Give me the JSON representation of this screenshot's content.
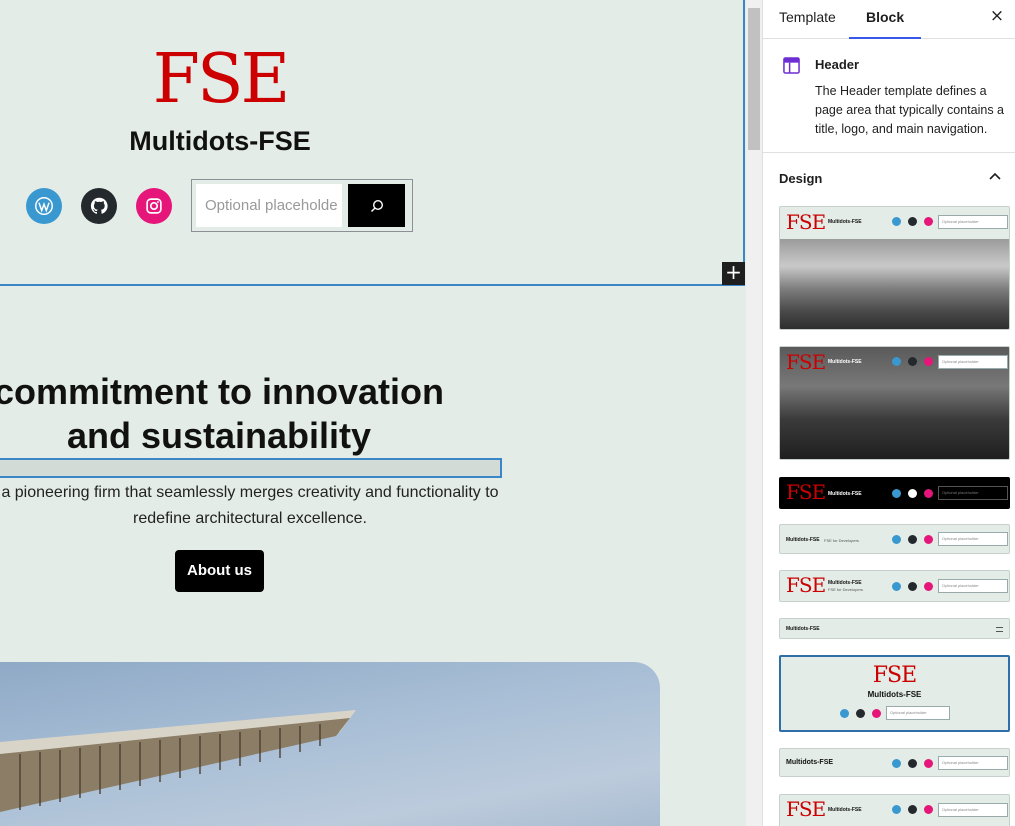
{
  "canvas": {
    "header": {
      "logo_text": "FSE",
      "site_title": "Multidots-FSE",
      "social_icons": [
        "wordpress-icon",
        "github-icon",
        "instagram-icon"
      ],
      "search_placeholder": "Optional placeholde"
    },
    "hero": {
      "title_line1": "commitment to innovation",
      "title_line2": "and sustainability",
      "desc_line1": "a pioneering firm that seamlessly merges creativity and functionality to",
      "desc_line2": "redefine architectural excellence.",
      "button_label": "About us"
    }
  },
  "sidebar": {
    "tabs": [
      {
        "label": "Template",
        "active": false
      },
      {
        "label": "Block",
        "active": true
      }
    ],
    "close_label": "×",
    "block": {
      "name": "Header",
      "description": "The Header template defines a page area that typically contains a title, logo, and main navigation."
    },
    "design": {
      "title": "Design",
      "patterns": {
        "logo": "FSE",
        "title": "Multidots-FSE",
        "tagline": "FSE for Developers",
        "search_placeholder": "Optional placeholder"
      }
    }
  },
  "colors": {
    "canvas_bg": "#e3ece7",
    "accent": "#3858e9",
    "selection": "#3a86c8",
    "logo_red": "#cc0000"
  }
}
